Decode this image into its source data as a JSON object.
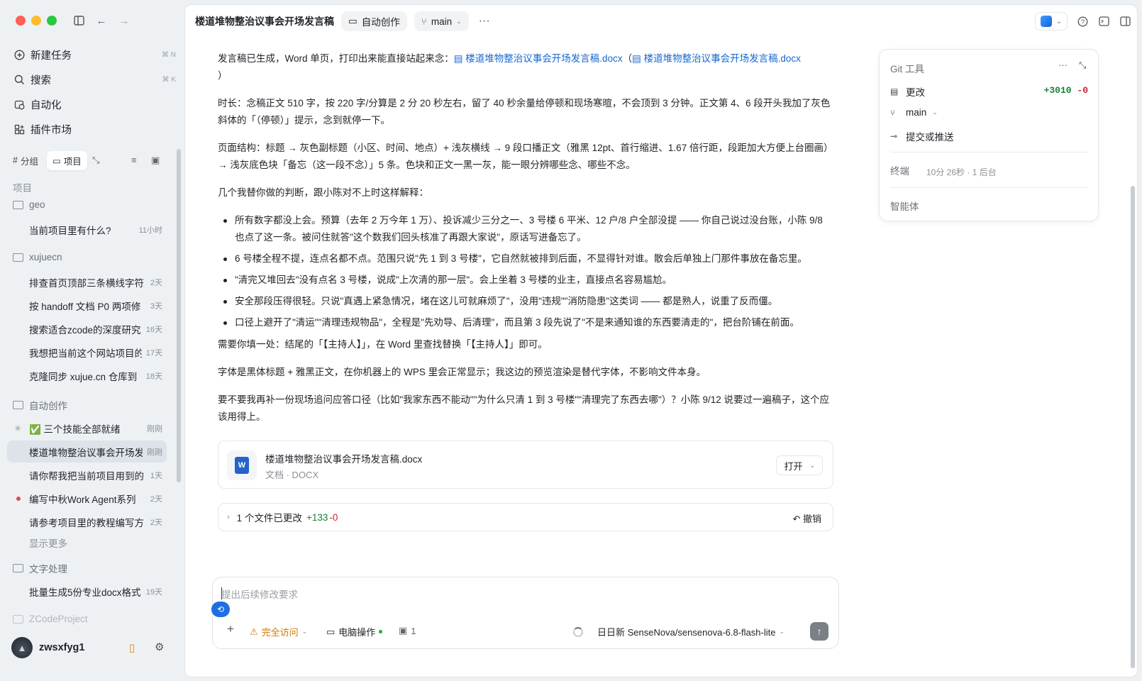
{
  "sidebar": {
    "nav": [
      {
        "label": "新建任务",
        "shortcut": "⌘ N"
      },
      {
        "label": "搜索",
        "shortcut": "⌘ K"
      },
      {
        "label": "自动化",
        "shortcut": ""
      },
      {
        "label": "插件市场",
        "shortcut": ""
      }
    ],
    "seg": {
      "group": "分组",
      "project": "项目"
    },
    "projects_header": "项目",
    "groups": [
      {
        "name": "geo"
      },
      {
        "name": "xujuecn"
      },
      {
        "name": "自动创作"
      },
      {
        "name": "文字处理"
      },
      {
        "name": "ZCodeProject"
      }
    ],
    "items": [
      {
        "title": "当前项目里有什么?",
        "time": "11小时"
      },
      {
        "title": "排查首页顶部三条横线字符",
        "time": "2天"
      },
      {
        "title": "按 handoff 文档 P0 两项修",
        "time": "3天"
      },
      {
        "title": "搜索适合zcode的深度研究",
        "time": "16天"
      },
      {
        "title": "我想把当前这个网站项目的",
        "time": "17天"
      },
      {
        "title": "克隆同步 xujue.cn 仓库到",
        "time": "18天"
      },
      {
        "title": "✅ 三个技能全部就绪",
        "time": "刚刚"
      },
      {
        "title": "楼道堆物整治议事会开场发",
        "time": "刚刚"
      },
      {
        "title": "请你帮我把当前项目用到的",
        "time": "1天"
      },
      {
        "title": "编写中秋Work Agent系列",
        "time": "2天"
      },
      {
        "title": "请参考项目里的教程编写方",
        "time": "2天"
      },
      {
        "title": "批量生成5份专业docx格式",
        "time": "19天"
      }
    ],
    "show_more": "显示更多",
    "user": "zwsxfyg1"
  },
  "header": {
    "title": "楼道堆物整治议事会开场发言稿",
    "folder": "自动创作",
    "branch": "main"
  },
  "message": {
    "p1_prefix": "发言稿已生成，Word 单页，打印出来能直接站起来念：",
    "file_link": "楼道堆物整治议事会开场发言稿.docx",
    "p1_open": "（",
    "p1_close": "）",
    "p2": "时长：念稿正文 510 字，按 220 字/分算是 2 分 20 秒左右，留了 40 秒余量给停顿和现场寒暄，不会顶到 3 分钟。正文第 4、6 段开头我加了灰色斜体的「（停顿）」提示，念到就停一下。",
    "p3": "页面结构：标题 → 灰色副标题（小区、时间、地点）+ 浅灰横线 → 9 段口播正文（雅黑 12pt、首行缩进、1.67 倍行距，段距加大方便上台圈画）→ 浅灰底色块「备忘（这一段不念）」5 条。色块和正文一黑一灰，能一眼分辨哪些念、哪些不念。",
    "p4": "几个我替你做的判断，跟小陈对不上时这样解释：",
    "bullets": [
      "所有数字都没上会。预算（去年 2 万今年 1 万）、投诉减少三分之一、3 号楼 6 平米、12 户/8 户全部没提 —— 你自己说过没台账，小陈 9/8 也点了这一条。被问住就答\"这个数我们回头核准了再跟大家说\"，原话写进备忘了。",
      "6 号楼全程不提，连点名都不点。范围只说\"先 1 到 3 号楼\"，它自然就被排到后面，不显得针对谁。散会后单独上门那件事放在备忘里。",
      "\"清完又堆回去\"没有点名 3 号楼，说成\"上次清的那一层\"。会上坐着 3 号楼的业主，直接点名容易尴尬。",
      "安全那段压得很轻。只说\"真遇上紧急情况，堵在这儿可就麻烦了\"，没用\"违规\"\"消防隐患\"这类词 —— 都是熟人，说重了反而僵。",
      "口径上避开了\"清运\"\"清理违规物品\"，全程是\"先劝导、后清理\"，而且第 3 段先说了\"不是来通知谁的东西要清走的\"，把台阶铺在前面。"
    ],
    "p5": "需要你填一处：结尾的「【主持人】」，在 Word 里查找替换「【主持人】」即可。",
    "p6": "字体是黑体标题 + 雅黑正文，在你机器上的 WPS 里会正常显示；我这边的预览渲染是替代字体，不影响文件本身。",
    "p7": "要不要我再补一份现场追问应答口径（比如\"我家东西不能动\"\"为什么只清 1 到 3 号楼\"\"清理完了东西去哪\"）？小陈 9/12 说要过一遍稿子，这个应该用得上。"
  },
  "file_card": {
    "name": "楼道堆物整治议事会开场发言稿.docx",
    "type": "文档 · DOCX",
    "open": "打开",
    "icon": "W"
  },
  "changes": {
    "label": "1 个文件已更改",
    "add": "+133",
    "del": "-0",
    "undo": "撤销"
  },
  "composer": {
    "placeholder": "提出后续修改要求",
    "access": "完全访问",
    "computer": "电脑操作",
    "count": "1",
    "model": "日日新 SenseNova/sensenova-6.8-flash-lite"
  },
  "git": {
    "title": "Git 工具",
    "changes": "更改",
    "add": "+3010",
    "del": "-0",
    "branch": "main",
    "commit": "提交或推送",
    "terminal": "终端",
    "terminal_info": "10分 26秒 · 1 后台",
    "agent": "智能体"
  },
  "colors": {
    "accent": "#1767d0",
    "add": "#1a7f37",
    "del": "#cf222e",
    "warn": "#d17a00"
  }
}
